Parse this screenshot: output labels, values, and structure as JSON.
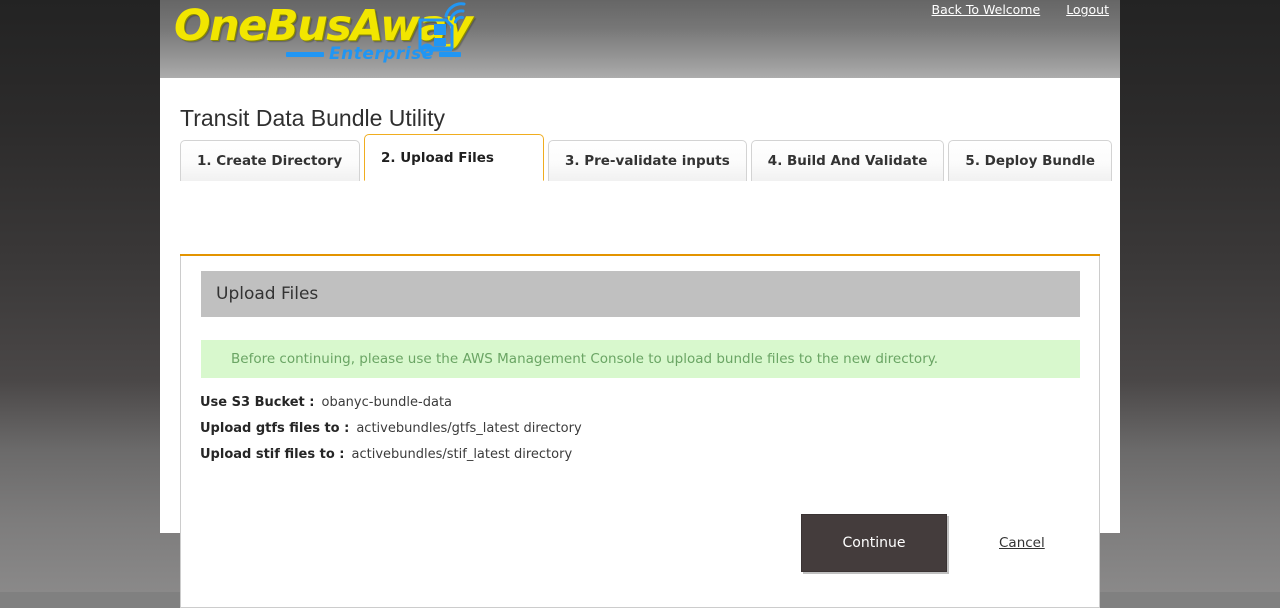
{
  "header": {
    "logo": {
      "main_text": "OneBusAway",
      "sub_text": "Enterprise",
      "bus_icon": "bus-wifi-icon",
      "yellow": "#f2e600",
      "blue": "#2196f3"
    },
    "links": [
      {
        "label": "Back To Welcome",
        "name": "back-to-welcome-link"
      },
      {
        "label": "Logout",
        "name": "logout-link"
      }
    ]
  },
  "page": {
    "title": "Transit Data Bundle Utility"
  },
  "tabs": {
    "active_index": 1,
    "items": [
      {
        "label": "1. Create Directory"
      },
      {
        "label": "2. Upload Files"
      },
      {
        "label": "3. Pre-validate inputs"
      },
      {
        "label": "4. Build And Validate"
      },
      {
        "label": "5. Deploy Bundle"
      }
    ]
  },
  "panel": {
    "heading": "Upload Files",
    "notice": "Before continuing, please use the AWS Management Console to upload bundle files to the new directory.",
    "notice_bg": "#d8f8cd",
    "notice_color": "#6aa564",
    "heading_bg": "#c0c0c0",
    "fields": [
      {
        "label": "Use S3 Bucket :",
        "value": "obanyc-bundle-data"
      },
      {
        "label": "Upload gtfs files to :",
        "value": "activebundles/gtfs_latest directory"
      },
      {
        "label": "Upload stif files to :",
        "value": "activebundles/stif_latest directory"
      }
    ],
    "actions": {
      "continue_label": "Continue",
      "cancel_label": "Cancel",
      "continue_bg": "#443c3c"
    }
  }
}
